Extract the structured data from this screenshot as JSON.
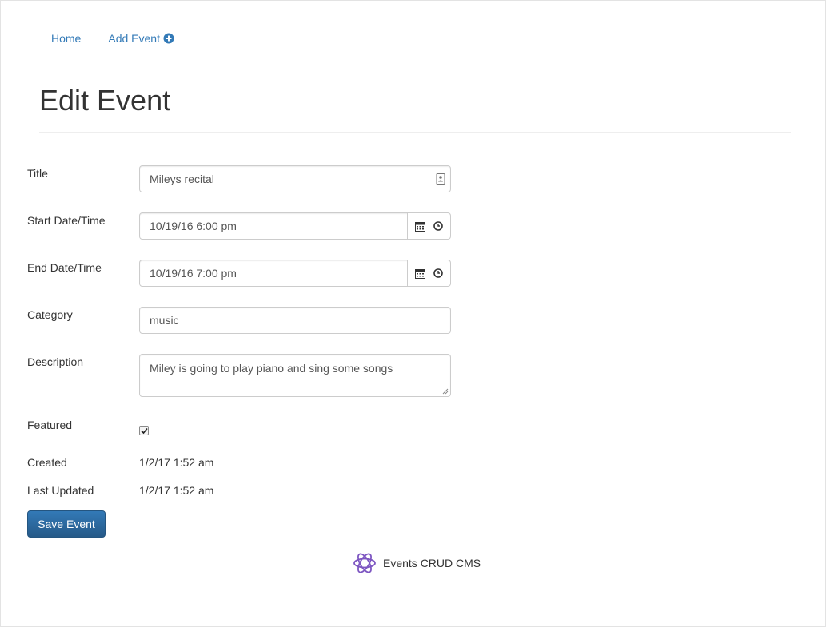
{
  "nav": {
    "home_label": "Home",
    "add_event_label": "Add Event"
  },
  "page": {
    "title": "Edit Event"
  },
  "form": {
    "title_label": "Title",
    "title_value": "Mileys recital",
    "start_label": "Start Date/Time",
    "start_value": "10/19/16 6:00 pm",
    "end_label": "End Date/Time",
    "end_value": "10/19/16 7:00 pm",
    "category_label": "Category",
    "category_value": "music",
    "description_label": "Description",
    "description_value": "Miley is going to play piano and sing some songs",
    "featured_label": "Featured",
    "featured_checked": true,
    "created_label": "Created",
    "created_value": "1/2/17 1:52 am",
    "updated_label": "Last Updated",
    "updated_value": "1/2/17 1:52 am",
    "save_label": "Save Event"
  },
  "footer": {
    "brand_label": "Events CRUD CMS"
  },
  "colors": {
    "link": "#337ab7",
    "primary": "#337ab7",
    "logo": "#7e57c2"
  },
  "icons": {
    "add": "plus-circle-icon",
    "contact": "contact-card-icon",
    "calendar": "calendar-icon",
    "clock": "clock-icon",
    "logo": "react-logo-icon"
  }
}
